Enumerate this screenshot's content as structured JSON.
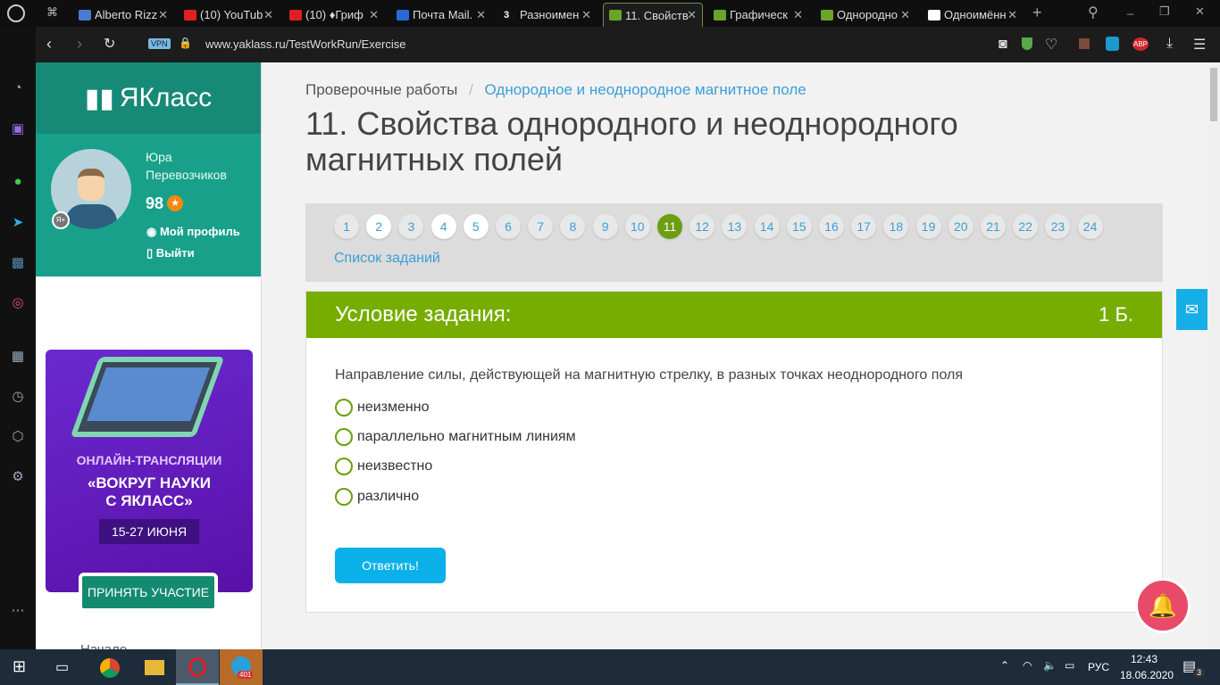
{
  "browser": {
    "tabs": [
      {
        "label": "Alberto Rizz",
        "color": "#4a7bd0"
      },
      {
        "label": "(10) YouTub",
        "color": "#e02020"
      },
      {
        "label": "(10) ♦Гриф",
        "color": "#e02020"
      },
      {
        "label": "Почта Mail.",
        "color": "#2a6ad8"
      },
      {
        "label": "Разноимен",
        "color": "#111"
      },
      {
        "label": "11. Свойств",
        "color": "#6aa52a"
      },
      {
        "label": "Графическ",
        "color": "#6aa52a"
      },
      {
        "label": "Однородно",
        "color": "#6aa52a"
      },
      {
        "label": "Одноимённ",
        "color": "#ffffff"
      }
    ],
    "url": "www.yaklass.ru/TestWorkRun/Exercise",
    "vpn": "VPN",
    "abp": "ABP",
    "tab5_icon": "3"
  },
  "sidebar": {
    "logo": "ЯКласс",
    "user_first": "Юра",
    "user_last": "Перевозчиков",
    "points": "98",
    "badge": "Я+",
    "profile_link": "Мой профиль",
    "logout_link": "Выйти",
    "promo": {
      "line1": "ОНЛАЙН-ТРАНСЛЯЦИИ",
      "line2": "«ВОКРУГ НАУКИ",
      "line3": "С ЯКЛАСС»",
      "dates": "15-27 ИЮНЯ",
      "button": "ПРИНЯТЬ УЧАСТИЕ"
    },
    "nav_start": "Начало"
  },
  "main": {
    "breadcrumb_root": "Проверочные работы",
    "breadcrumb_sep": "/",
    "breadcrumb_topic": "Однородное и неоднородное магнитное поле",
    "title": "11. Свойства однородного и неоднородного магнитных полей",
    "pages": [
      "1",
      "2",
      "3",
      "4",
      "5",
      "6",
      "7",
      "8",
      "9",
      "10",
      "11",
      "12",
      "13",
      "14",
      "15",
      "16",
      "17",
      "18",
      "19",
      "20",
      "21",
      "22",
      "23",
      "24"
    ],
    "done_pages": [
      "2",
      "4",
      "5"
    ],
    "current_page": "11",
    "task_list": "Список заданий",
    "task_header": "Условие задания:",
    "points": "1 Б.",
    "question": "Направление силы, действующей на магнитную стрелку, в разных точках неоднородного поля",
    "options": [
      "неизменно",
      "параллельно магнитным линиям",
      "неизвестно",
      "различно"
    ],
    "submit": "Ответить!"
  },
  "taskbar": {
    "lang": "РУС",
    "time": "12:43",
    "date": "18.06.2020",
    "notifications": "3",
    "telegram_badge": "401"
  }
}
